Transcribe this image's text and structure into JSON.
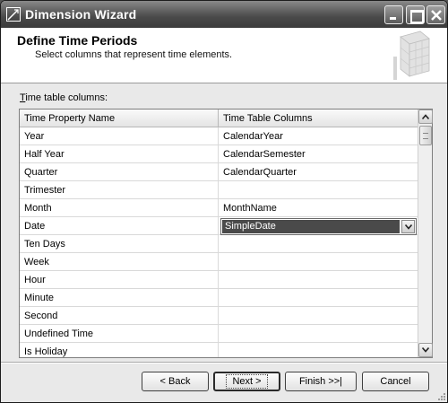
{
  "window": {
    "title": "Dimension Wizard",
    "icon": "wizard-app-icon"
  },
  "header": {
    "title": "Define Time Periods",
    "subtitle": "Select columns that represent time elements.",
    "graphic": "cube-graphic"
  },
  "section": {
    "label_prefix": "T",
    "label_rest": "ime table columns:"
  },
  "grid": {
    "columns": [
      "Time Property Name",
      "Time Table Columns"
    ],
    "rows": [
      {
        "name": "Year",
        "value": "CalendarYear"
      },
      {
        "name": "Half Year",
        "value": "CalendarSemester"
      },
      {
        "name": "Quarter",
        "value": "CalendarQuarter"
      },
      {
        "name": "Trimester",
        "value": ""
      },
      {
        "name": "Month",
        "value": "MonthName"
      },
      {
        "name": "Date",
        "value": "SimpleDate"
      },
      {
        "name": "Ten Days",
        "value": ""
      },
      {
        "name": "Week",
        "value": ""
      },
      {
        "name": "Hour",
        "value": ""
      },
      {
        "name": "Minute",
        "value": ""
      },
      {
        "name": "Second",
        "value": ""
      },
      {
        "name": "Undefined Time",
        "value": ""
      },
      {
        "name": "Is Holiday",
        "value": ""
      }
    ],
    "selected_row": 5
  },
  "buttons": {
    "back": "< Back",
    "next": "Next >",
    "finish": "Finish >>|",
    "cancel": "Cancel"
  },
  "colors": {
    "titlebar": "#4a4a4a",
    "selection": "#4a4a4a"
  }
}
